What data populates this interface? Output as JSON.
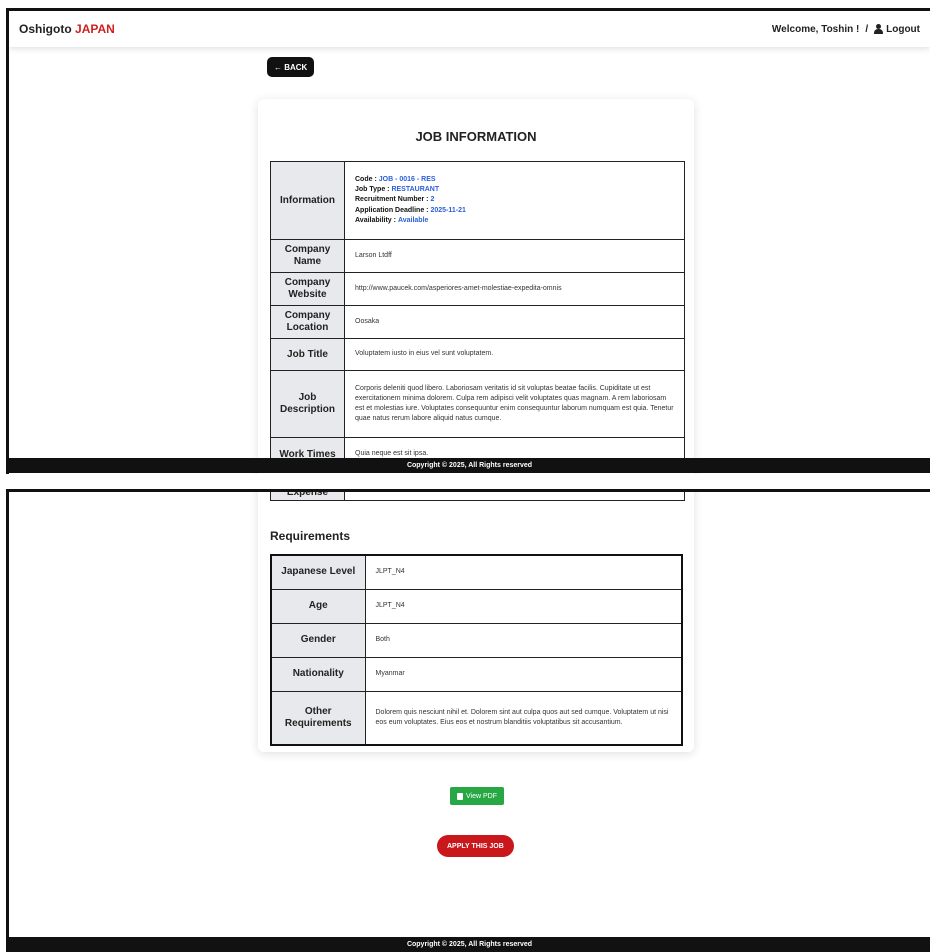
{
  "navbar": {
    "brand_main": "Oshigoto",
    "brand_accent": "JAPAN",
    "welcome": "Welcome, Toshin !",
    "separator": "/",
    "logout": "Logout"
  },
  "back_button": "← BACK",
  "job_info": {
    "title": "JOB INFORMATION",
    "info_label": "Information",
    "code_key": "Code :",
    "code_val": "JOB - 0016 - RES",
    "type_key": "Job Type :",
    "type_val": "RESTAURANT",
    "recruit_key": "Recruitment Number :",
    "recruit_val": "2",
    "deadline_key": "Application Deadline :",
    "deadline_val": "2025-11-21",
    "avail_key": "Availability :",
    "avail_val": "Available",
    "rows": [
      {
        "label": "Company Name",
        "value": "Larson Ltdff"
      },
      {
        "label": "Company Website",
        "value": "http://www.paucek.com/asperiores-amet-molestiae-expedita-omnis"
      },
      {
        "label": "Company Location",
        "value": "Oosaka"
      },
      {
        "label": "Job Title",
        "value": "Voluptatem iusto in eius vel sunt voluptatem."
      },
      {
        "label": "Job Description",
        "value": "Corporis deleniti quod libero. Laboriosam veritatis id sit voluptas beatae facilis. Cupiditate ut est exercitationem minima dolorem. Culpa rem adipisci velit voluptates quas magnam. A rem laboriosam est et molestias iure. Voluptates consequuntur enim consequuntur laborum numquam est quia. Tenetur quae natus rerum labore aliquid natus cumque."
      },
      {
        "label": "Work Times",
        "value": "Quia neque est sit ipsa."
      }
    ],
    "expense_label": "Expense"
  },
  "requirements": {
    "title": "Requirements",
    "rows": [
      {
        "label": "Japanese Level",
        "value": "JLPT_N4"
      },
      {
        "label": "Age",
        "value": "JLPT_N4"
      },
      {
        "label": "Gender",
        "value": "Both"
      },
      {
        "label": "Nationality",
        "value": "Myanmar"
      },
      {
        "label": "Other Requirements",
        "value": "Dolorem quis nesciunt nihil et. Dolorem sint aut culpa quos aut sed cumque. Voluptatem ut nisi eos eum voluptates. Eius eos et nostrum blanditiis voluptatibus sit accusantium."
      }
    ]
  },
  "view_pdf": "View PDF",
  "apply_button": "APPLY THIS JOB",
  "footer": "Copyright © 2025, All Rights reserved",
  "colors": {
    "accent_red": "#d21f1f",
    "link_blue": "#2b5fd9",
    "pdf_green": "#28a745",
    "apply_red": "#c9171c"
  }
}
